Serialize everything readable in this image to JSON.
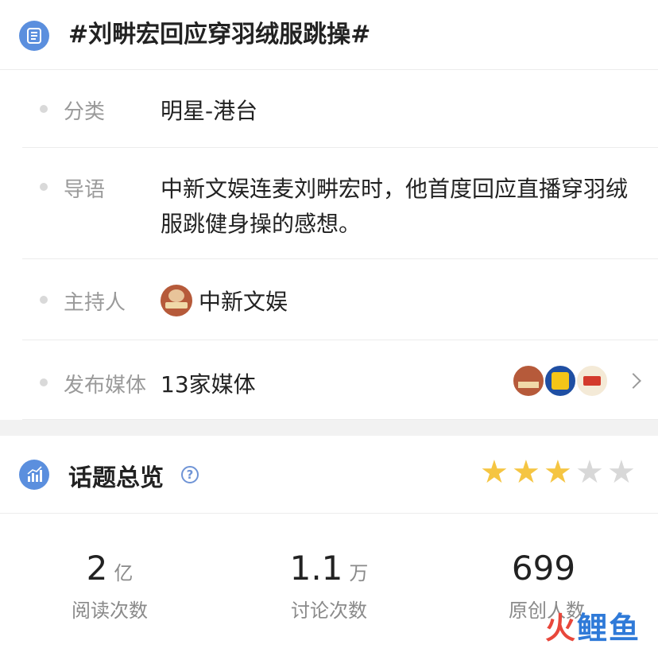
{
  "topic": {
    "title": "#刘畊宏回应穿羽绒服跳操#"
  },
  "info_rows": {
    "category": {
      "label": "分类",
      "value": "明星-港台"
    },
    "intro": {
      "label": "导语",
      "value": "中新文娱连麦刘畊宏时，他首度回应直播穿羽绒服跳健身操的感想。"
    },
    "host": {
      "label": "主持人",
      "value": "中新文娱"
    },
    "media": {
      "label": "发布媒体",
      "value": "13家媒体"
    }
  },
  "overview": {
    "title": "话题总览",
    "help": "?",
    "rating": {
      "stars_filled": 3,
      "stars_total": 5
    },
    "star_colors": {
      "filled": "#f5c542",
      "empty": "#d8d8d8"
    }
  },
  "stats": [
    {
      "number": "2",
      "unit": "亿",
      "label": "阅读次数"
    },
    {
      "number": "1.1",
      "unit": "万",
      "label": "讨论次数"
    },
    {
      "number": "699",
      "unit": "",
      "label": "原创人数"
    }
  ],
  "watermark": {
    "part1": "火",
    "part2": "鲤鱼"
  },
  "icons": {
    "topic": "list-icon",
    "overview": "bar-chart-icon",
    "help": "help-icon",
    "chevron": "chevron-right-icon"
  }
}
